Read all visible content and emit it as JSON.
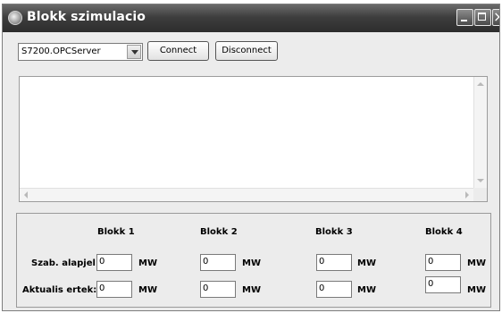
{
  "window": {
    "title": "Blokk szimulacio"
  },
  "toolbar": {
    "server_select": "S7200.OPCServer",
    "connect_label": "Connect",
    "disconnect_label": "Disconnect"
  },
  "log": {
    "text": ""
  },
  "blocks": {
    "headers": [
      "Blokk 1",
      "Blokk 2",
      "Blokk 3",
      "Blokk 4"
    ],
    "unit": "MW",
    "rows": [
      {
        "label": "Szab. alapjel:",
        "values": [
          "0",
          "0",
          "0",
          "0"
        ]
      },
      {
        "label": "Aktualis ertek:",
        "values": [
          "0",
          "0",
          "0",
          "0"
        ]
      }
    ]
  }
}
